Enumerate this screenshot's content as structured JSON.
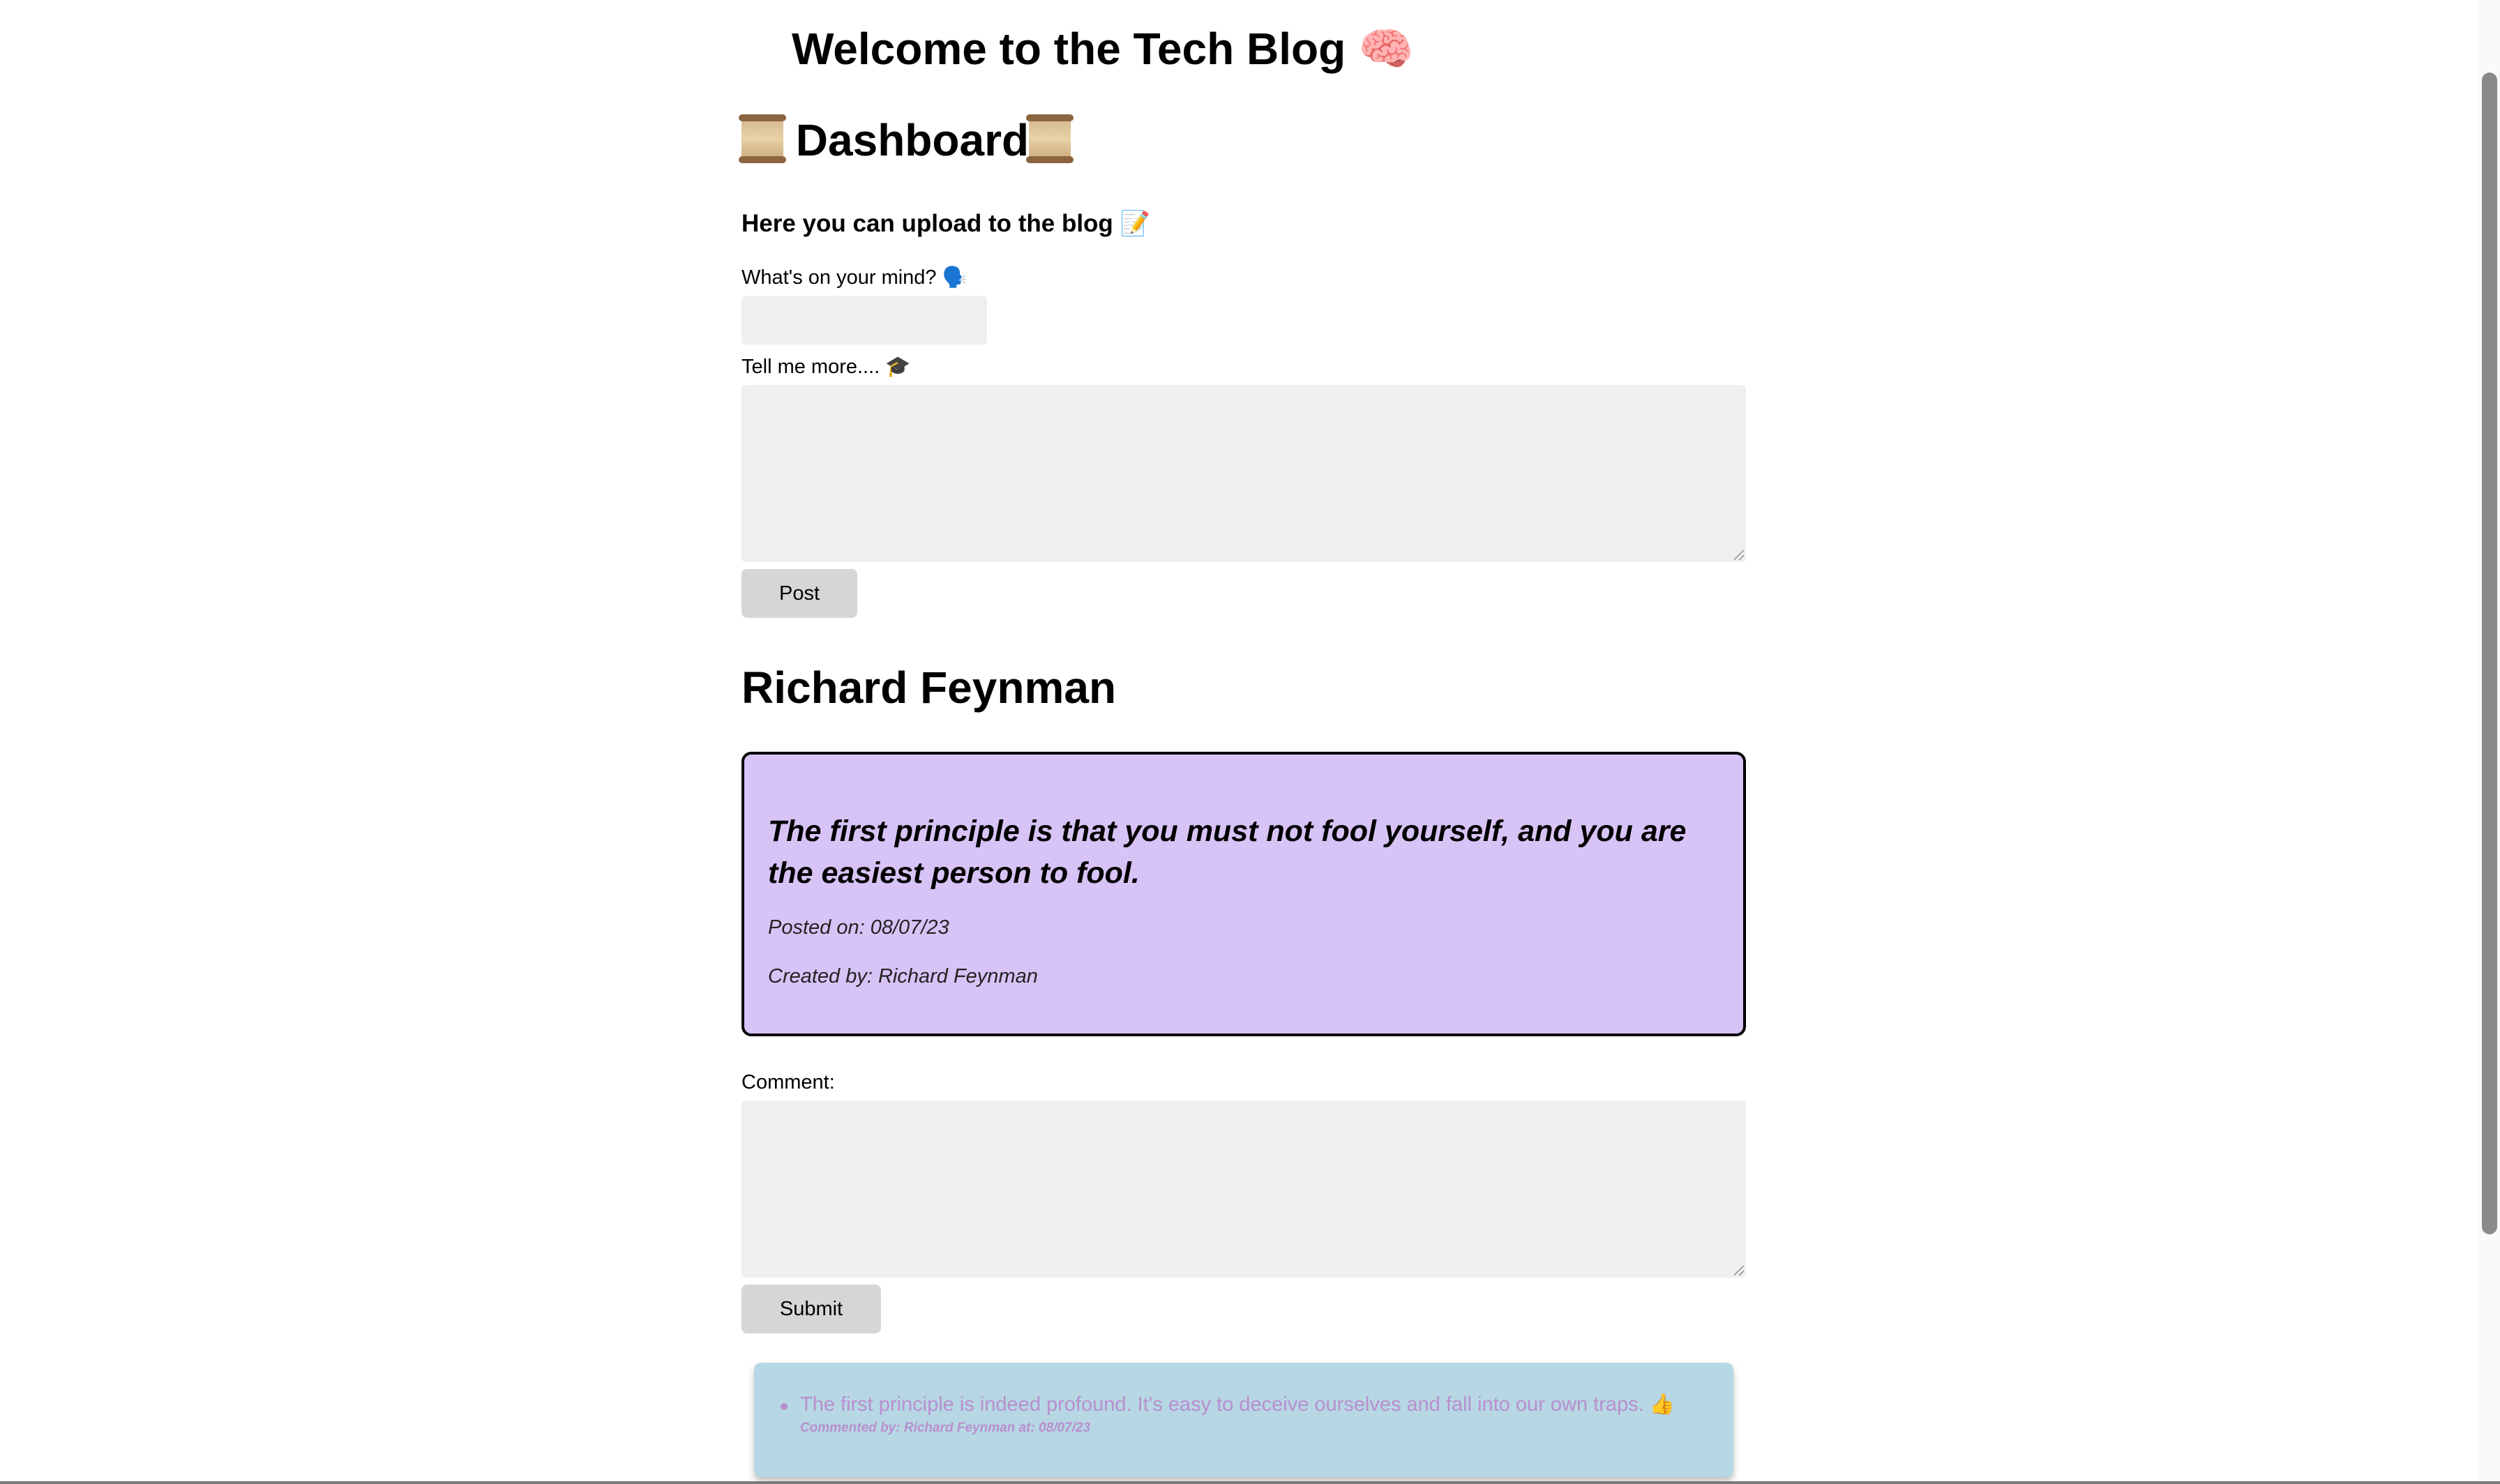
{
  "header": {
    "site_title": "Welcome to the Tech Blog",
    "site_title_emoji": "🧠"
  },
  "dashboard": {
    "title": "Dashboard",
    "upload_heading": "Here you can upload to the blog",
    "upload_heading_emoji": "📝",
    "title_field_label": "What's on your mind?",
    "title_field_emoji": "🗣️",
    "title_field_value": "",
    "body_field_label": "Tell me more....",
    "body_field_emoji": "🎓",
    "body_field_value": "",
    "post_button_label": "Post"
  },
  "post": {
    "author_heading": "Richard Feynman",
    "body": "The first principle is that you must not fool yourself, and you are the easiest person to fool.",
    "posted_on": "Posted on: 08/07/23",
    "created_by": "Created by: Richard Feynman"
  },
  "comment_form": {
    "label": "Comment:",
    "value": "",
    "submit_button_label": "Submit"
  },
  "comments": [
    {
      "text": "The first principle is indeed profound. It's easy to deceive ourselves and fall into our own traps. 👍",
      "meta": "Commented by: Richard Feynman at: 08/07/23"
    }
  ],
  "colors": {
    "post_card_bg": "#d8c3f6",
    "comments_bg": "#b6d7e3",
    "comment_text": "#b98fd0",
    "input_bg": "#efefef",
    "button_bg": "#d6d6d6"
  }
}
